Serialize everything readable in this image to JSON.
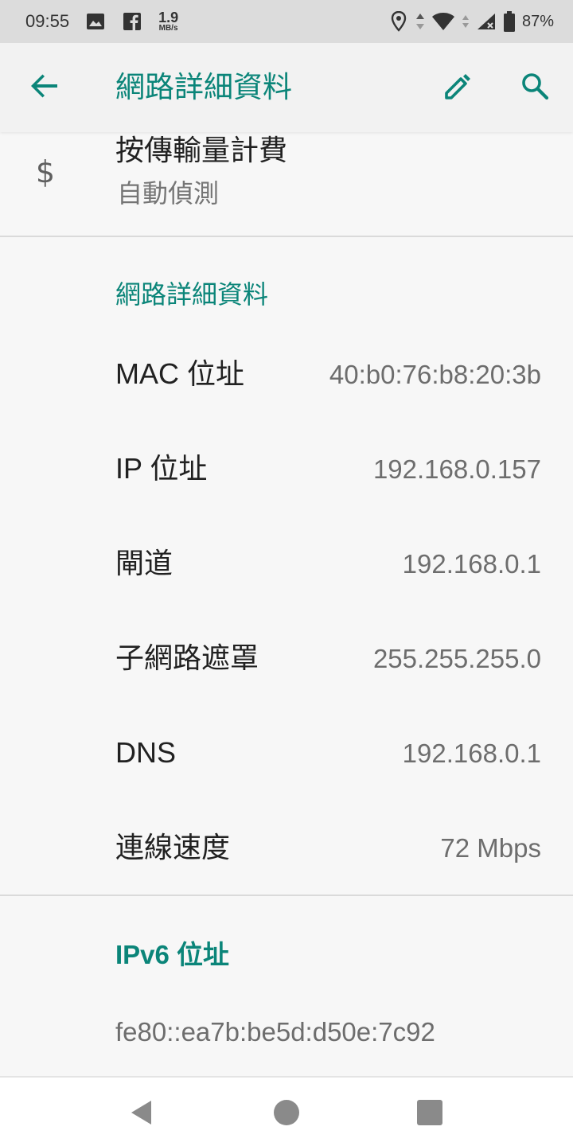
{
  "status_bar": {
    "time": "09:55",
    "netspeed_value": "1.9",
    "netspeed_unit": "MB/s",
    "battery_percent": "87%",
    "icons": [
      "image-icon",
      "facebook-icon",
      "location-icon",
      "data-arrows-icon",
      "wifi-icon",
      "cell-signal-icon",
      "battery-icon"
    ]
  },
  "app_bar": {
    "title": "網路詳細資料",
    "back_icon": "arrow-back-icon",
    "edit_icon": "pencil-icon",
    "search_icon": "search-icon",
    "accent_color": "#0b8579"
  },
  "metered": {
    "title": "按傳輸量計費",
    "subtitle": "自動偵測",
    "icon": "dollar-icon"
  },
  "network_details": {
    "header": "網路詳細資料",
    "rows": [
      {
        "label": "MAC 位址",
        "value": "40:b0:76:b8:20:3b"
      },
      {
        "label": "IP 位址",
        "value": "192.168.0.157"
      },
      {
        "label": "閘道",
        "value": "192.168.0.1"
      },
      {
        "label": "子網路遮罩",
        "value": "255.255.255.0"
      },
      {
        "label": "DNS",
        "value": "192.168.0.1"
      },
      {
        "label": "連線速度",
        "value": "72 Mbps"
      }
    ]
  },
  "ipv6": {
    "header": "IPv6 位址",
    "value": "fe80::ea7b:be5d:d50e:7c92"
  },
  "nav_bar": {
    "icons": [
      "nav-back-icon",
      "nav-home-icon",
      "nav-recents-icon"
    ]
  }
}
